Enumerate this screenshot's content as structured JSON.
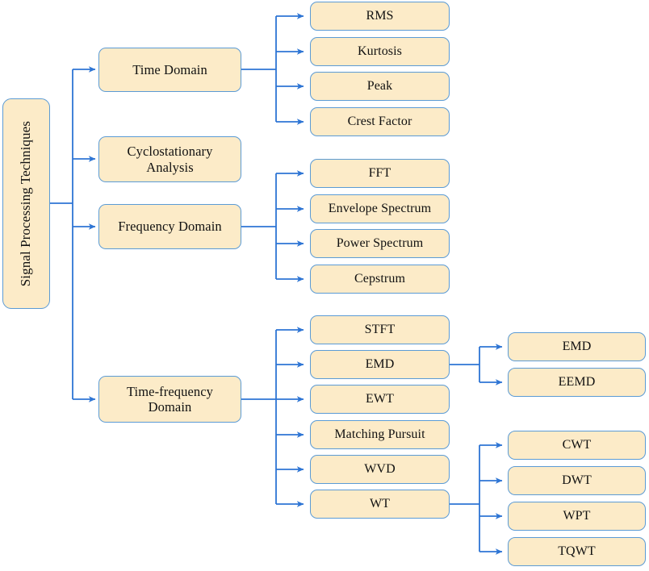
{
  "diagram": {
    "title": "Signal Processing Techniques taxonomy",
    "colors": {
      "node_fill": "#FCEBC8",
      "node_border": "#5B9BD5",
      "connector": "#2E75D4",
      "background": "#FFFFFF",
      "text": "#111111"
    },
    "root": {
      "label": "Signal Processing Techniques"
    },
    "level1": [
      {
        "id": "time-domain",
        "label": "Time Domain"
      },
      {
        "id": "cyclostationary-analysis",
        "label": "Cyclostationary\nAnalysis"
      },
      {
        "id": "frequency-domain",
        "label": "Frequency Domain"
      },
      {
        "id": "time-frequency-domain",
        "label": "Time-frequency\nDomain"
      }
    ],
    "level2": {
      "time_domain": [
        {
          "id": "rms",
          "label": "RMS"
        },
        {
          "id": "kurtosis",
          "label": "Kurtosis"
        },
        {
          "id": "peak",
          "label": "Peak"
        },
        {
          "id": "crest-factor",
          "label": "Crest Factor"
        }
      ],
      "frequency_domain": [
        {
          "id": "fft",
          "label": "FFT"
        },
        {
          "id": "envelope-spectrum",
          "label": "Envelope Spectrum"
        },
        {
          "id": "power-spectrum",
          "label": "Power Spectrum"
        },
        {
          "id": "cepstrum",
          "label": "Cepstrum"
        }
      ],
      "time_frequency_domain": [
        {
          "id": "stft",
          "label": "STFT"
        },
        {
          "id": "emd",
          "label": "EMD"
        },
        {
          "id": "ewt",
          "label": "EWT"
        },
        {
          "id": "matching-pursuit",
          "label": "Matching Pursuit"
        },
        {
          "id": "wvd",
          "label": "WVD"
        },
        {
          "id": "wt",
          "label": "WT"
        }
      ]
    },
    "level3": {
      "emd": [
        {
          "id": "emd-leaf",
          "label": "EMD"
        },
        {
          "id": "eemd",
          "label": "EEMD"
        }
      ],
      "wt": [
        {
          "id": "cwt",
          "label": "CWT"
        },
        {
          "id": "dwt",
          "label": "DWT"
        },
        {
          "id": "wpt",
          "label": "WPT"
        },
        {
          "id": "tqwt",
          "label": "TQWT"
        }
      ]
    }
  }
}
